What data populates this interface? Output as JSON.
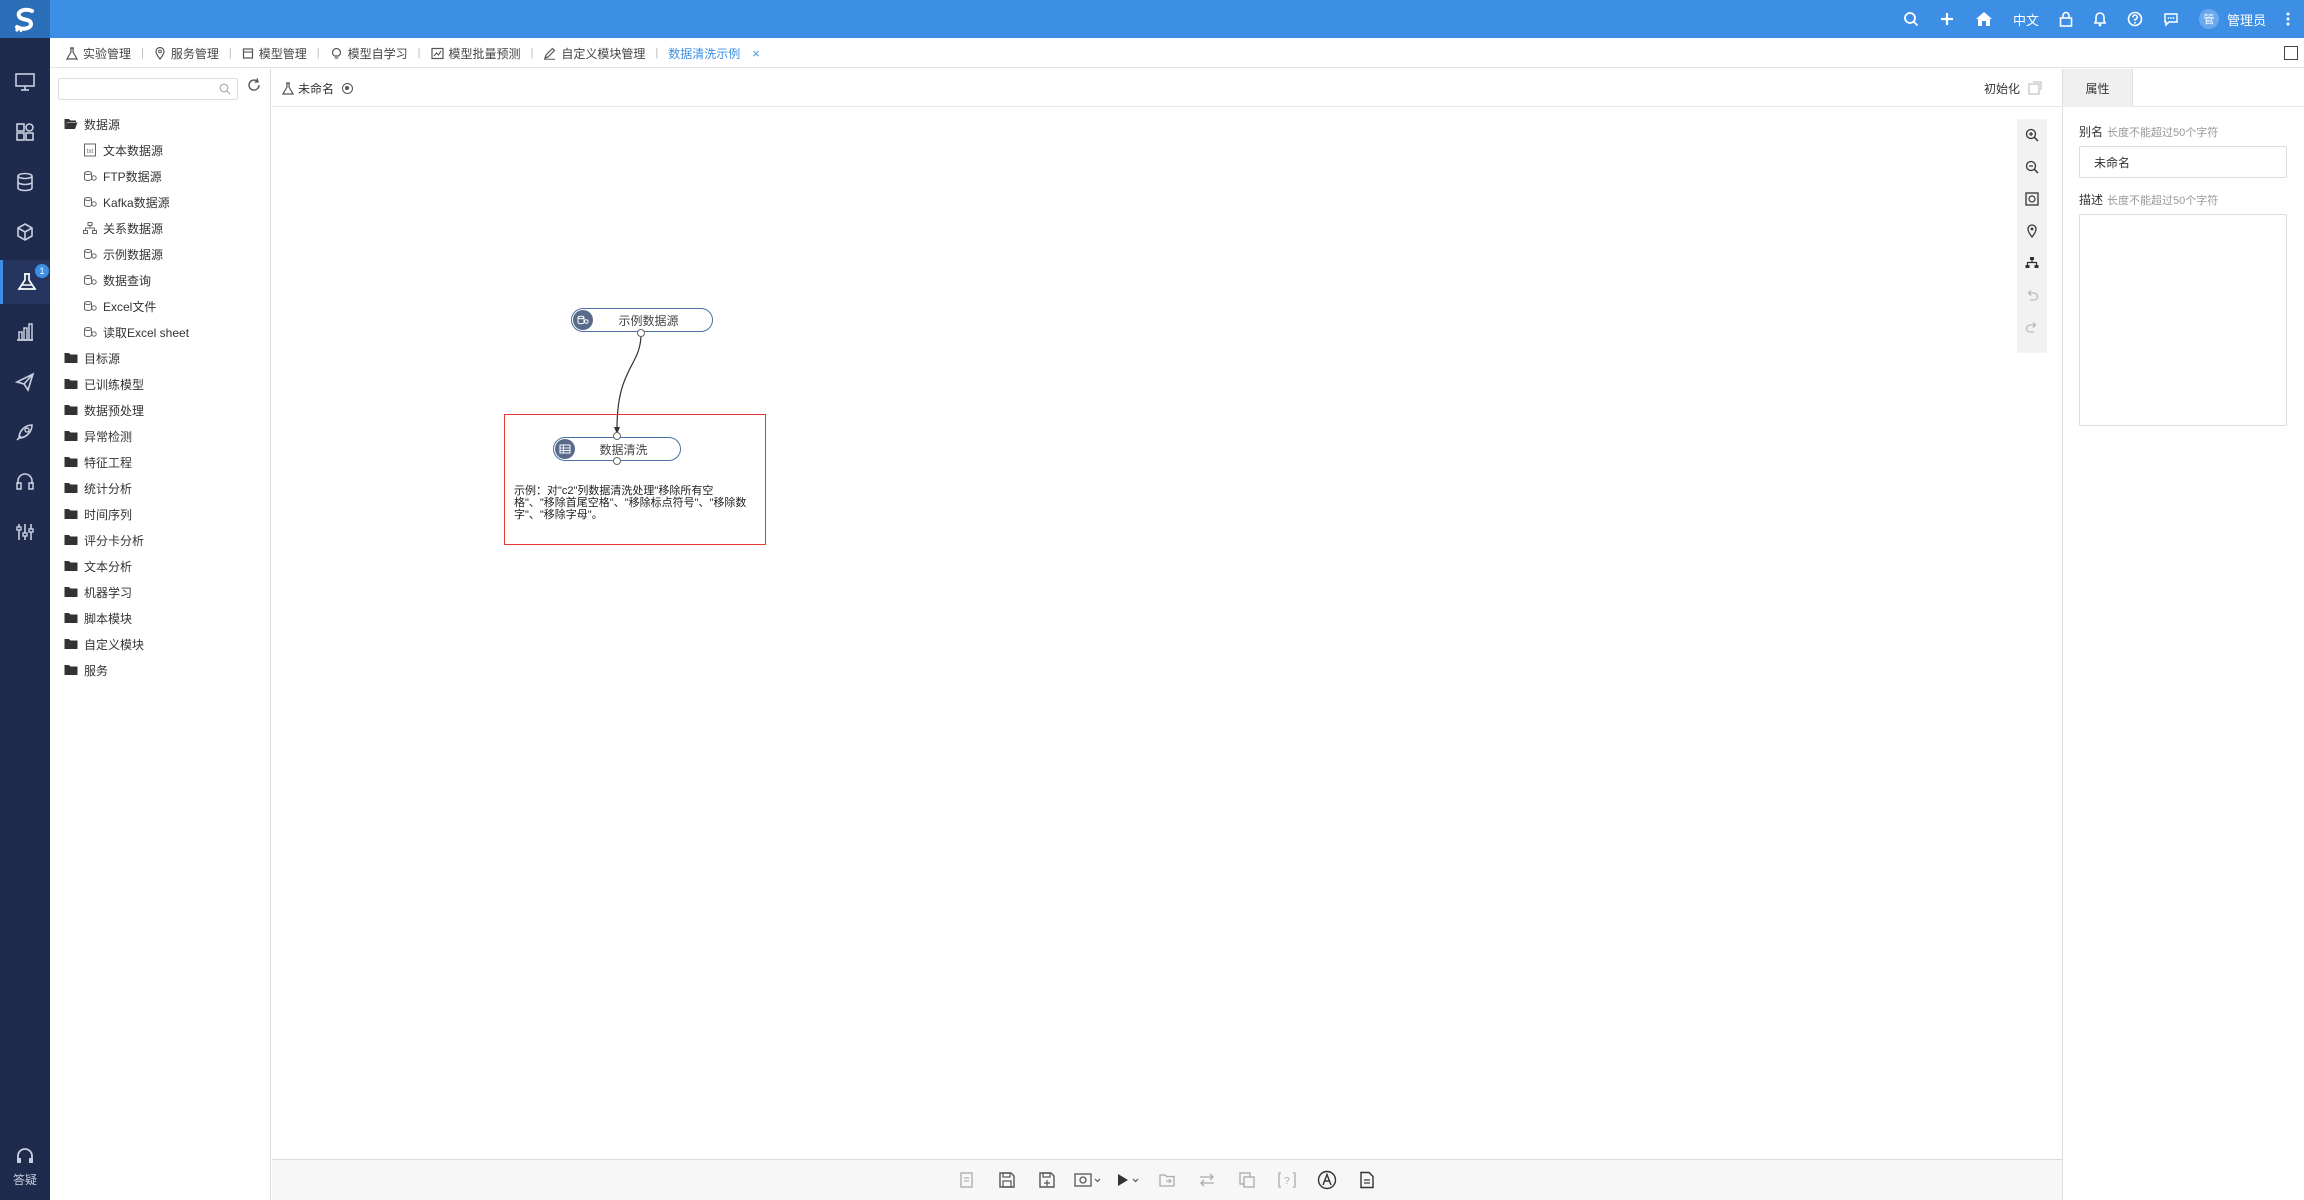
{
  "topbar": {
    "lang": "中文",
    "avatar_text": "管",
    "user": "管理员",
    "icons": [
      "search-icon",
      "plus-icon",
      "home-icon",
      "lock-icon",
      "bell-icon",
      "help-icon",
      "chat-icon",
      "more-icon"
    ]
  },
  "tabs": [
    {
      "label": "实验管理"
    },
    {
      "label": "服务管理"
    },
    {
      "label": "模型管理"
    },
    {
      "label": "模型自学习"
    },
    {
      "label": "模型批量预测"
    },
    {
      "label": "自定义模块管理"
    },
    {
      "label": "数据清洗示例",
      "active": true
    }
  ],
  "tab_close": "×",
  "left_nav": {
    "badge": "1",
    "help_label": "答疑"
  },
  "tree": {
    "root": "数据源",
    "children": [
      "文本数据源",
      "FTP数据源",
      "Kafka数据源",
      "关系数据源",
      "示例数据源",
      "数据查询",
      "Excel文件",
      "读取Excel sheet"
    ],
    "folders": [
      "目标源",
      "已训练模型",
      "数据预处理",
      "异常检测",
      "特征工程",
      "统计分析",
      "时间序列",
      "评分卡分析",
      "文本分析",
      "机器学习",
      "脚本模块",
      "自定义模块",
      "服务"
    ]
  },
  "canvas": {
    "experiment_name": "未命名",
    "init_label": "初始化",
    "nodes": [
      {
        "label": "示例数据源"
      },
      {
        "label": "数据清洗"
      }
    ],
    "note": "示例：对\"c2\"列数据清洗处理\"移除所有空格\"、\"移除首尾空格\"、\"移除标点符号\"、\"移除数字\"、\"移除字母\"。"
  },
  "properties": {
    "tab": "属性",
    "alias_label": "别名",
    "alias_hint": "长度不能超过50个字符",
    "alias_value": "未命名",
    "desc_label": "描述",
    "desc_hint": "长度不能超过50个字符"
  },
  "colors": {
    "topbar": "#3d8fe6",
    "sidebar": "#1f2b4c",
    "accent": "#3d8fe6",
    "highlight": "#e53935"
  }
}
